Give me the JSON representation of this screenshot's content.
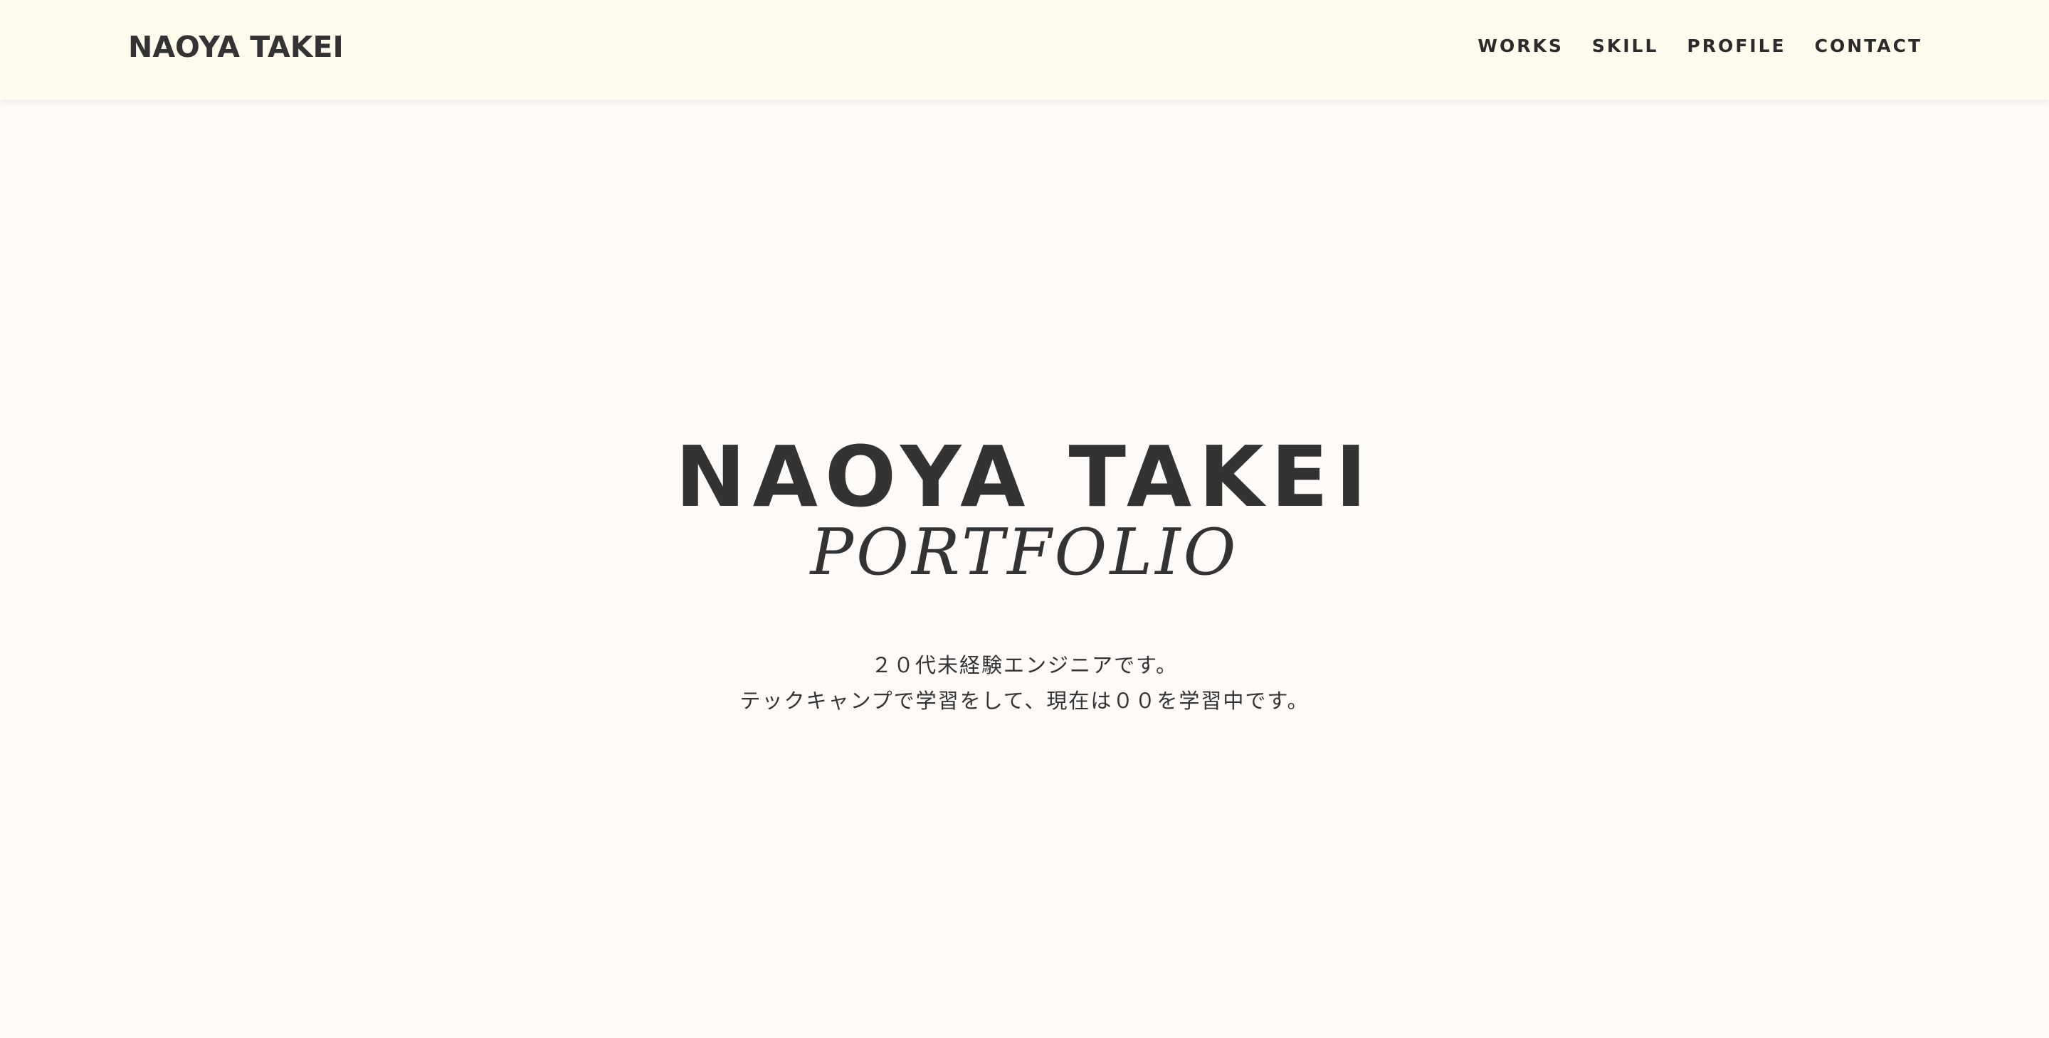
{
  "header": {
    "logo": "NAOYA TAKEI",
    "nav": [
      "WORKS",
      "SKILL",
      "PROFILE",
      "CONTACT"
    ]
  },
  "hero": {
    "name": "NAOYA TAKEI",
    "subtitle": "PORTFOLIO",
    "description_line1": "２０代未経験エンジニアです。",
    "description_line2": "テックキャンプで学習をして、現在は００を学習中です。"
  },
  "colors": {
    "header_bg": "#fefaec",
    "page_bg": "#fdfaf8",
    "text": "#333333"
  }
}
